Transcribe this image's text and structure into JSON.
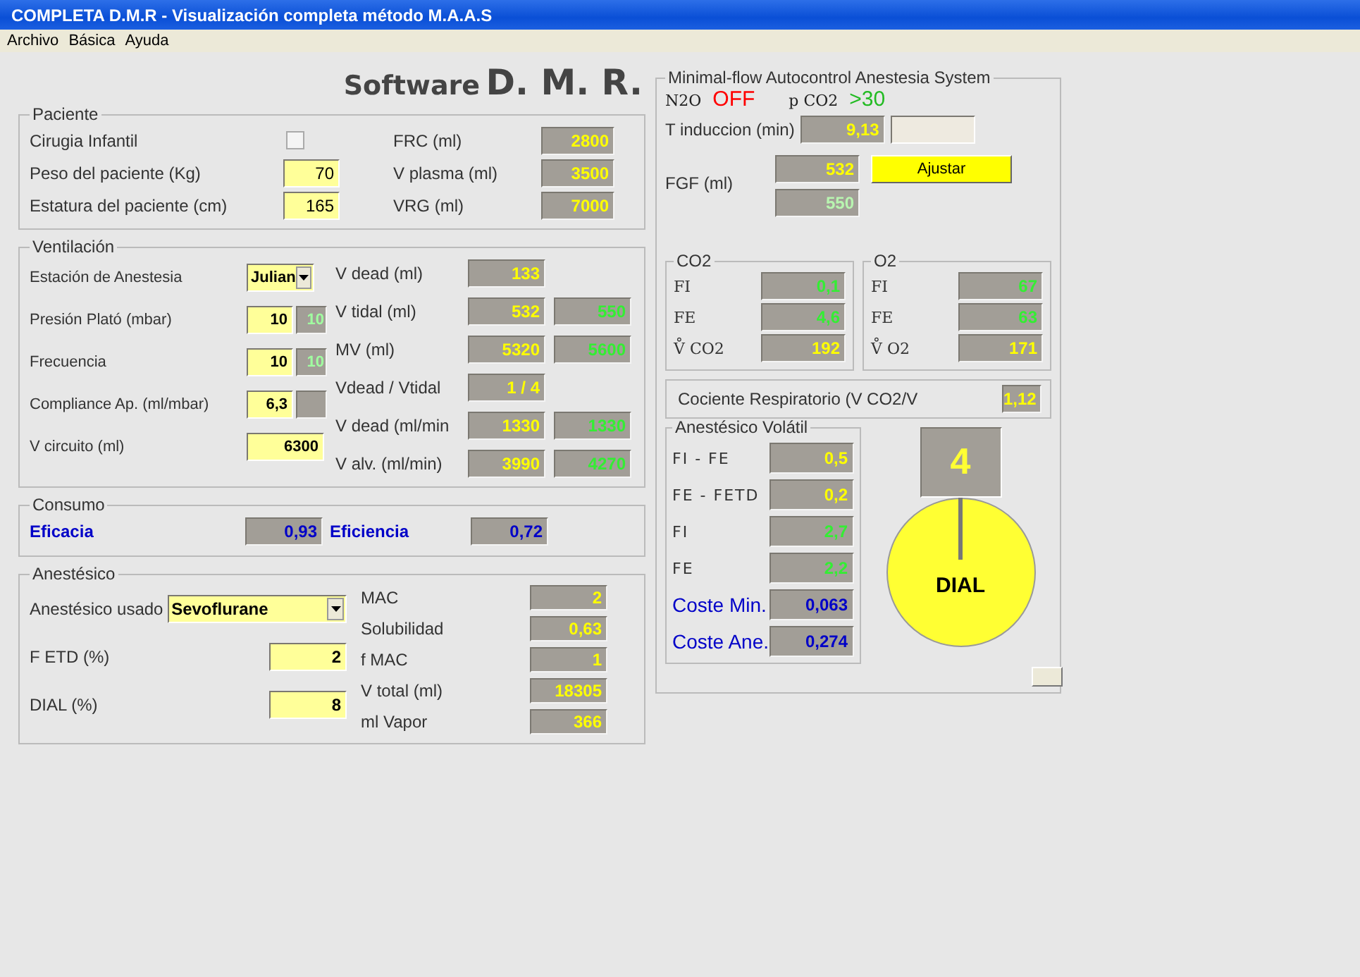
{
  "window": {
    "title": "COMPLETA D.M.R - Visualización completa método M.A.A.S"
  },
  "menu": [
    {
      "label": "Archivo"
    },
    {
      "label": "Básica"
    },
    {
      "label": "Ayuda"
    }
  ],
  "heading": {
    "prefix": "Software",
    "main": "D. M. R."
  },
  "paciente": {
    "title": "Paciente",
    "rows": [
      {
        "label": "Cirugia Infantil",
        "kind": "checkbox",
        "checked": false,
        "out_label": "FRC (ml)",
        "out": {
          "text": "2800",
          "kind": "calc"
        }
      },
      {
        "label": "Peso del paciente (Kg)",
        "kind": "input",
        "value": "70",
        "out_label": "V plasma (ml)",
        "out": {
          "text": "3500",
          "kind": "calc"
        }
      },
      {
        "label": "Estatura del paciente (cm)",
        "kind": "input",
        "value": "165",
        "out_label": "VRG (ml)",
        "out": {
          "text": "7000",
          "kind": "calc"
        }
      }
    ]
  },
  "ventilacion": {
    "title": "Ventilación",
    "left": [
      {
        "label": "Estación de Anestesia",
        "kind": "select",
        "value": "Julian"
      },
      {
        "label": "Presión Plató (mbar)",
        "kind": "input",
        "value": "10",
        "outputs": [
          {
            "text": "10",
            "kind": "ref"
          }
        ]
      },
      {
        "label": "Frecuencia",
        "kind": "input",
        "value": "10",
        "outputs": [
          {
            "text": "10",
            "kind": "ref"
          }
        ]
      },
      {
        "label": "Compliance Ap. (ml/mbar)",
        "kind": "input",
        "value": "6,3",
        "blank_box": true
      },
      {
        "label": "V circuito (ml)",
        "kind": "wide_input",
        "value": "6300"
      }
    ],
    "right": [
      {
        "label": "V dead (ml)",
        "outputs": [
          {
            "text": "133",
            "kind": "calc"
          }
        ]
      },
      {
        "label": "V tidal (ml)",
        "outputs": [
          {
            "text": "532",
            "kind": "calc"
          },
          {
            "text": "550",
            "kind": "ref"
          }
        ]
      },
      {
        "label": "MV (ml)",
        "outputs": [
          {
            "text": "5320",
            "kind": "calc"
          },
          {
            "text": "5600",
            "kind": "ref"
          }
        ]
      },
      {
        "label": "Vdead / Vtidal",
        "outputs": [
          {
            "text": "1 / 4",
            "kind": "calc"
          }
        ]
      },
      {
        "label": "V dead  (ml/min",
        "outputs": [
          {
            "text": "1330",
            "kind": "calc"
          },
          {
            "text": "1330",
            "kind": "ref"
          }
        ]
      },
      {
        "label": "V alv. (ml/min)",
        "outputs": [
          {
            "text": "3990",
            "kind": "calc"
          },
          {
            "text": "4270",
            "kind": "ref"
          }
        ]
      }
    ]
  },
  "consumo": {
    "title": "Consumo",
    "items": [
      {
        "label": "Eficacia",
        "text": "0,93"
      },
      {
        "label": "Eficiencia",
        "text": "0,72"
      }
    ]
  },
  "anestesico": {
    "title": "Anestésico",
    "left": [
      {
        "label": "Anestésico usado",
        "kind": "select",
        "value": "Sevoflurane"
      },
      {
        "label": "F ETD (%)",
        "kind": "input",
        "value": "2"
      },
      {
        "label": "DIAL (%)",
        "kind": "input",
        "value": "8"
      }
    ],
    "right": [
      {
        "label": "MAC",
        "out": {
          "text": "2",
          "kind": "calc"
        }
      },
      {
        "label": "Solubilidad",
        "out": {
          "text": "0,63",
          "kind": "calc"
        }
      },
      {
        "label": "f MAC",
        "out": {
          "text": "1",
          "kind": "calc"
        }
      },
      {
        "label": "V total (ml)",
        "out": {
          "text": "18305",
          "kind": "calc"
        }
      },
      {
        "label": "ml Vapor",
        "out": {
          "text": "366",
          "kind": "calc"
        }
      }
    ]
  },
  "maas": {
    "title": "Minimal-flow Autocontrol Anestesia System",
    "status": [
      {
        "label": "N2O",
        "value": "OFF",
        "kind": "alarm"
      },
      {
        "label": "p CO2",
        "value": ">30",
        "kind": "ok"
      }
    ],
    "t_induccion": {
      "label": "T induccion (min)",
      "out": {
        "text": "9,13",
        "kind": "calc"
      },
      "light_box": true
    },
    "fgf": {
      "label": "FGF (ml)",
      "outputs": [
        {
          "text": "532",
          "kind": "calc"
        },
        {
          "text": "550",
          "kind": "dim"
        }
      ],
      "button": "Ajustar"
    },
    "gases": [
      {
        "title": "CO2",
        "rows": [
          {
            "label": "FI",
            "out": {
              "text": "0,1",
              "kind": "ref"
            }
          },
          {
            "label": "FE",
            "out": {
              "text": "4,6",
              "kind": "ref"
            }
          },
          {
            "label": "V̊ CO2",
            "out": {
              "text": "192",
              "kind": "calc"
            }
          }
        ]
      },
      {
        "title": "O2",
        "rows": [
          {
            "label": "FI",
            "out": {
              "text": "67",
              "kind": "ref"
            }
          },
          {
            "label": "FE",
            "out": {
              "text": "63",
              "kind": "ref"
            }
          },
          {
            "label": "V̊ O2",
            "out": {
              "text": "171",
              "kind": "calc"
            }
          }
        ]
      }
    ],
    "cociente": {
      "label": "Cociente Respiratorio  (V CO2/V",
      "out": {
        "text": "1,12",
        "kind": "calc"
      }
    },
    "volatil": {
      "title": "Anestésico Volátil",
      "rows": [
        {
          "label": "FI - FE",
          "kind": "measure",
          "out": {
            "text": "0,5",
            "kind": "calc"
          }
        },
        {
          "label": "FE - FETD",
          "kind": "measure",
          "out": {
            "text": "0,2",
            "kind": "calc"
          }
        },
        {
          "label": "FI",
          "kind": "measure",
          "out": {
            "text": "2,7",
            "kind": "ref"
          }
        },
        {
          "label": "FE",
          "kind": "measure",
          "out": {
            "text": "2,2",
            "kind": "ref"
          }
        },
        {
          "label": "Coste Min.",
          "kind": "cost",
          "out": {
            "text": "0,063",
            "kind": "cost"
          }
        },
        {
          "label": "Coste Ane.",
          "kind": "cost",
          "out": {
            "text": "0,274",
            "kind": "cost"
          }
        }
      ]
    },
    "dial": {
      "value": "4",
      "label": "DIAL"
    }
  }
}
